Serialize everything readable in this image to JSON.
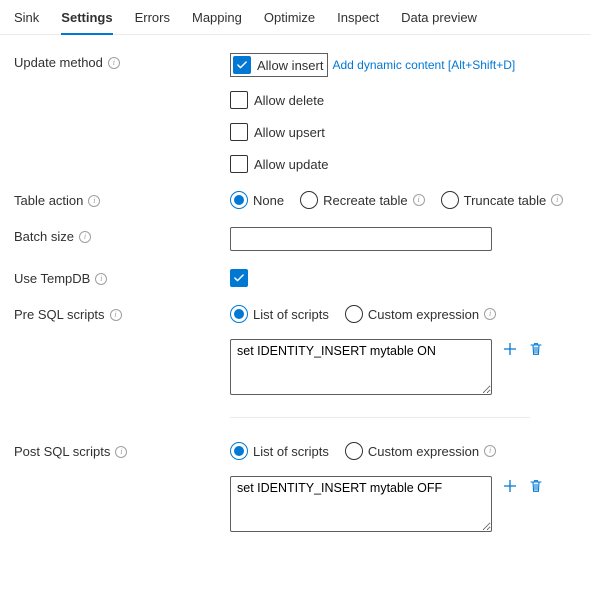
{
  "tabs": {
    "items": [
      "Sink",
      "Settings",
      "Errors",
      "Mapping",
      "Optimize",
      "Inspect",
      "Data preview"
    ],
    "activeIndex": 1
  },
  "updateMethod": {
    "label": "Update method",
    "allowInsert": {
      "label": "Allow insert",
      "checked": true
    },
    "allowDelete": {
      "label": "Allow delete",
      "checked": false
    },
    "allowUpsert": {
      "label": "Allow upsert",
      "checked": false
    },
    "allowUpdate": {
      "label": "Allow update",
      "checked": false
    },
    "dynamicLink": "Add dynamic content [Alt+Shift+D]"
  },
  "tableAction": {
    "label": "Table action",
    "options": {
      "none": "None",
      "recreate": "Recreate table",
      "truncate": "Truncate table"
    },
    "selected": "none"
  },
  "batchSize": {
    "label": "Batch size",
    "value": ""
  },
  "useTempDb": {
    "label": "Use TempDB",
    "checked": true
  },
  "preSql": {
    "label": "Pre SQL scripts",
    "mode": {
      "list": "List of scripts",
      "custom": "Custom expression",
      "selected": "list"
    },
    "script": "set IDENTITY_INSERT mytable ON"
  },
  "postSql": {
    "label": "Post SQL scripts",
    "mode": {
      "list": "List of scripts",
      "custom": "Custom expression",
      "selected": "list"
    },
    "script": "set IDENTITY_INSERT mytable OFF"
  }
}
